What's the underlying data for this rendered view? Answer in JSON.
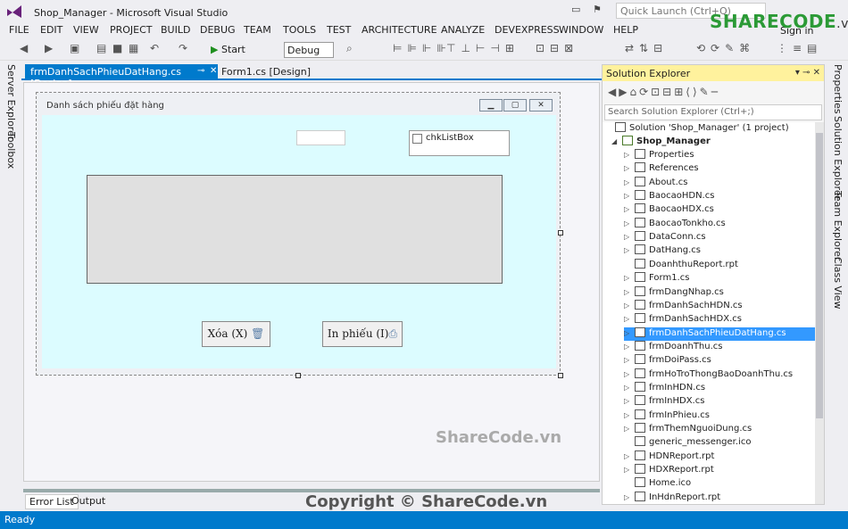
{
  "app": {
    "title": "Shop_Manager - Microsoft Visual Studio",
    "quick_launch": "Quick Launch (Ctrl+Q)",
    "sign_in": "Sign in",
    "brand_main": "SHARECODE",
    "brand_suffix": ".vn"
  },
  "menu": [
    "FILE",
    "EDIT",
    "VIEW",
    "PROJECT",
    "BUILD",
    "DEBUG",
    "TEAM",
    "TOOLS",
    "TEST",
    "ARCHITECTURE",
    "ANALYZE",
    "DEVEXPRESS",
    "WINDOW",
    "HELP"
  ],
  "toolbar": {
    "start_label": "Start",
    "config": "Debug"
  },
  "left_strip": [
    "Server Explorer",
    "Toolbox"
  ],
  "right_strip": [
    "Properties",
    "Solution Explorer",
    "Team Explorer",
    "Class View"
  ],
  "tabs": {
    "active": "frmDanhSachPhieuDatHang.cs [Design]",
    "inactive": "Form1.cs [Design]"
  },
  "form": {
    "title": "Danh sách phiếu đặt hàng",
    "checklist_label": "chkListBox",
    "delete_button": "Xóa (X)",
    "print_button": "In phiếu (I)"
  },
  "bottom_tabs": [
    "Error List",
    "Output"
  ],
  "watermark": "ShareCode.vn",
  "copyright": "Copyright © ShareCode.vn",
  "status": "Ready",
  "solution_explorer": {
    "title": "Solution Explorer",
    "search": "Search Solution Explorer (Ctrl+;)",
    "solution": "Solution 'Shop_Manager' (1 project)",
    "project": "Shop_Manager",
    "items": [
      "Properties",
      "References",
      "About.cs",
      "BaocaoHDN.cs",
      "BaocaoHDX.cs",
      "BaocaoTonkho.cs",
      "DataConn.cs",
      "DatHang.cs",
      "DoanhthuReport.rpt",
      "Form1.cs",
      "frmDangNhap.cs",
      "frmDanhSachHDN.cs",
      "frmDanhSachHDX.cs",
      "frmDanhSachPhieuDatHang.cs",
      "frmDoanhThu.cs",
      "frmDoiPass.cs",
      "frmHoTroThongBaoDoanhThu.cs",
      "frmInHDN.cs",
      "frmInHDX.cs",
      "frmInPhieu.cs",
      "frmThemNguoiDung.cs",
      "generic_messenger.ico",
      "HDNReport.rpt",
      "HDXReport.rpt",
      "Home.ico",
      "InHdnReport.rpt"
    ],
    "selected_index": 13
  }
}
